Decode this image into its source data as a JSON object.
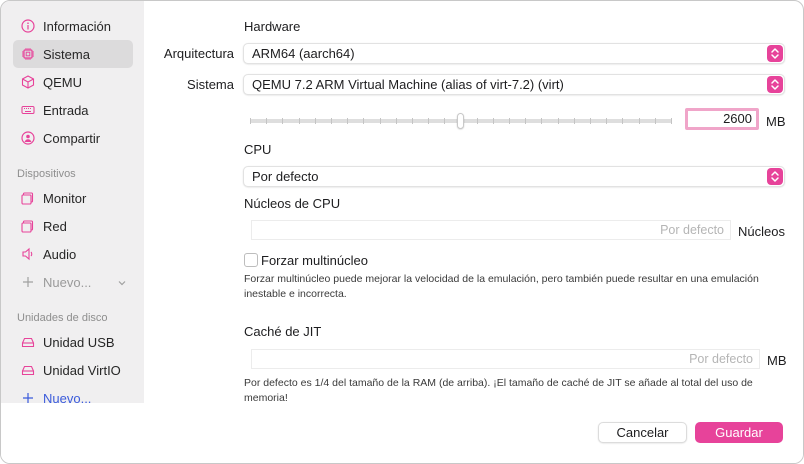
{
  "sidebar": {
    "items": [
      {
        "label": "Información",
        "icon": "info-icon"
      },
      {
        "label": "Sistema",
        "icon": "cpu-chip-icon",
        "selected": true
      },
      {
        "label": "QEMU",
        "icon": "cube-icon"
      },
      {
        "label": "Entrada",
        "icon": "keyboard-icon"
      },
      {
        "label": "Compartir",
        "icon": "share-icon"
      }
    ],
    "devices_header": "Dispositivos",
    "devices": [
      {
        "label": "Monitor",
        "icon": "monitor-icon"
      },
      {
        "label": "Red",
        "icon": "network-icon"
      },
      {
        "label": "Audio",
        "icon": "speaker-icon"
      }
    ],
    "devices_new": "Nuevo...",
    "drives_header": "Unidades de disco",
    "drives": [
      {
        "label": "Unidad USB",
        "icon": "drive-icon"
      },
      {
        "label": "Unidad VirtIO",
        "icon": "drive-icon"
      }
    ],
    "drives_new": "Nuevo..."
  },
  "hardware": {
    "title": "Hardware",
    "architecture_label": "Arquitectura",
    "architecture_value": "ARM64 (aarch64)",
    "system_label": "Sistema",
    "system_value": "QEMU 7.2 ARM Virtual Machine (alias of virt-7.2) (virt)",
    "memory_value": "2600",
    "memory_unit": "MB",
    "memory_slider_fraction": 0.5
  },
  "cpu": {
    "title": "CPU",
    "value": "Por defecto"
  },
  "cores": {
    "title": "Núcleos de CPU",
    "placeholder": "Por defecto",
    "unit": "Núcleos"
  },
  "multicore": {
    "label": "Forzar multinúcleo",
    "checked": false,
    "help": "Forzar multinúcleo puede mejorar la velocidad de la emulación, pero también puede resultar en una emulación inestable e incorrecta."
  },
  "jit": {
    "title": "Caché de JIT",
    "placeholder": "Por defecto",
    "unit": "MB",
    "help": "Por defecto es 1/4 del tamaño de la RAM (de arriba). ¡El tamaño de caché de JIT se añade al total del uso de memoria!"
  },
  "footer": {
    "cancel_label": "Cancelar",
    "save_label": "Guardar"
  },
  "colors": {
    "accent": "#e7439a",
    "sidebar_bg": "#f0eff0",
    "selected_bg": "#dcdbdc"
  }
}
